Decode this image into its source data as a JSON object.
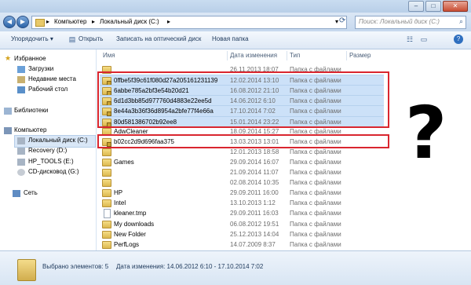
{
  "window": {
    "minimize": "–",
    "maximize": "□",
    "close": "✕"
  },
  "address": {
    "crumbs": [
      "Компьютер",
      "Локальный диск (C:)"
    ],
    "separator": "▸",
    "search_placeholder": "Поиск: Локальный диск (C:)"
  },
  "toolbar": {
    "organize": "Упорядочить ▾",
    "open": "Открыть",
    "burn": "Записать на оптический диск",
    "new_folder": "Новая папка"
  },
  "sidebar": {
    "favorites": "Избранное",
    "fav_items": [
      "Загрузки",
      "Недавние места",
      "Рабочий стол"
    ],
    "libraries": "Библиотеки",
    "computer": "Компьютер",
    "drives": [
      "Локальный диск (C:)",
      "Recovery (D:)",
      "HP_TOOLS (E:)",
      "CD-дисковод (G:)"
    ],
    "network": "Сеть"
  },
  "columns": {
    "name": "Имя",
    "date": "Дата изменения",
    "type": "Тип",
    "size": "Размер"
  },
  "files": [
    {
      "name": "",
      "date": "26.11.2013 18:07",
      "type": "Папка с файлами",
      "selected": false
    },
    {
      "name": "0ffbe5f39c61f080d27a205161231139",
      "date": "12.02.2014 13:10",
      "type": "Папка с файлами",
      "selected": true
    },
    {
      "name": "6abbe785a2bf3e54b20d21",
      "date": "16.08.2012 21:10",
      "type": "Папка с файлами",
      "selected": true
    },
    {
      "name": "6d1d3bb85d977760d4883e22ee5d",
      "date": "14.06.2012 6:10",
      "type": "Папка с файлами",
      "selected": true
    },
    {
      "name": "8e44a3b36f36d8954a2bfe77f4e66a",
      "date": "17.10.2014 7:02",
      "type": "Папка с файлами",
      "selected": true
    },
    {
      "name": "80d581386702b92ee8",
      "date": "15.01.2014 23:22",
      "type": "Папка с файлами",
      "selected": true
    },
    {
      "name": "AdwCleaner",
      "date": "18.09.2014 15:27",
      "type": "Папка с файлами",
      "selected": false
    },
    {
      "name": "b02cc2d9d696faa375",
      "date": "13.03.2013 13:01",
      "type": "Папка с файлами",
      "selected": false
    },
    {
      "name": "",
      "date": "12.01.2013 18:58",
      "type": "Папка с файлами",
      "selected": false
    },
    {
      "name": "Games",
      "date": "29.09.2014 16:07",
      "type": "Папка с файлами",
      "selected": false
    },
    {
      "name": "",
      "date": "21.09.2014 11:07",
      "type": "Папка с файлами",
      "selected": false
    },
    {
      "name": "",
      "date": "02.08.2014 10:35",
      "type": "Папка с файлами",
      "selected": false
    },
    {
      "name": "HP",
      "date": "29.09.2011 16:00",
      "type": "Папка с файлами",
      "selected": false
    },
    {
      "name": "Intel",
      "date": "13.10.2013 1:12",
      "type": "Папка с файлами",
      "selected": false
    },
    {
      "name": "kleaner.tmp",
      "date": "29.09.2011 16:03",
      "type": "Папка с файлами",
      "selected": false
    },
    {
      "name": "My downloads",
      "date": "06.08.2012 19:51",
      "type": "Папка с файлами",
      "selected": false
    },
    {
      "name": "New Folder",
      "date": "25.12.2013 14:04",
      "type": "Папка с файлами",
      "selected": false
    },
    {
      "name": "PerfLogs",
      "date": "14.07.2009 8:37",
      "type": "Папка с файлами",
      "selected": false
    }
  ],
  "annotation": {
    "qmark": "?"
  },
  "status": {
    "selected": "Выбрано элементов: 5",
    "date_label": "Дата изменения: 14.06.2012 6:10 - 17.10.2014 7:02"
  },
  "colors": {
    "selection": "#cce1f8",
    "highlight_box": "#d9262f"
  }
}
